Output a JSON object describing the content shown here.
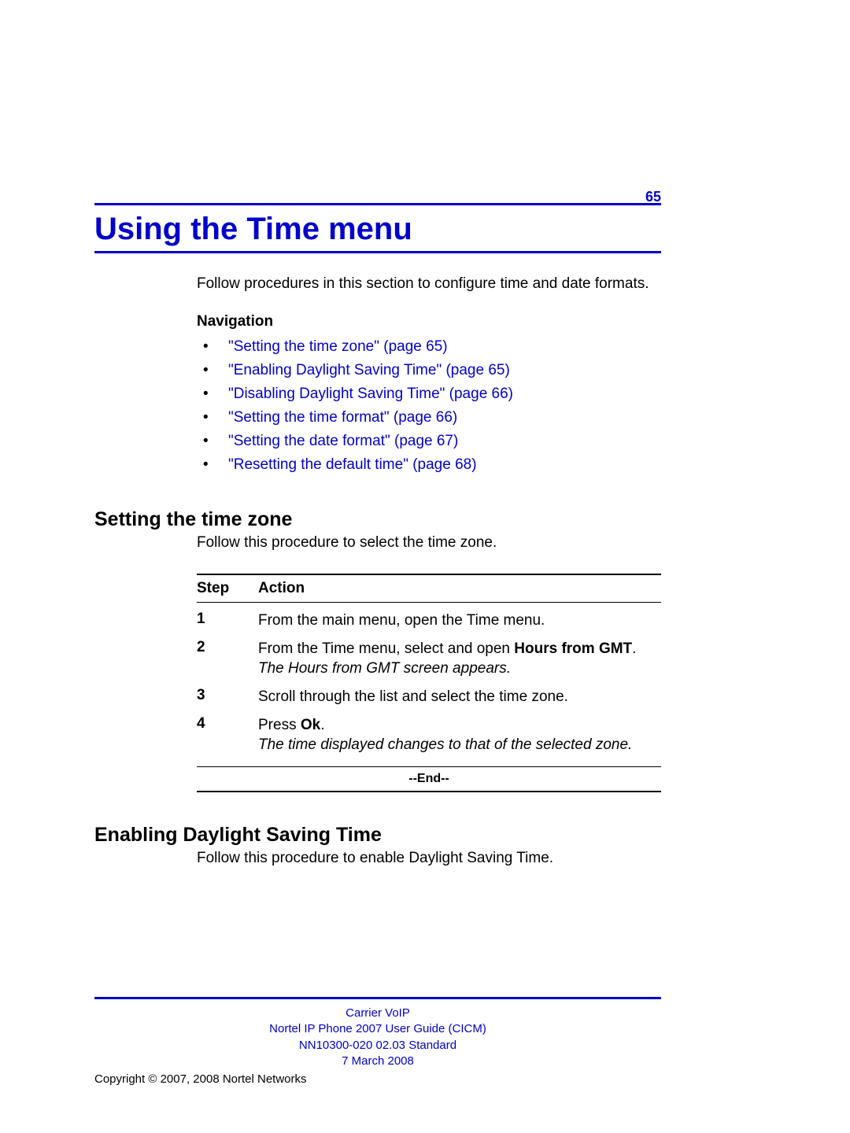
{
  "page_number": "65",
  "chapter_title": "Using the Time menu",
  "intro": "Follow procedures in this section to configure time and date formats.",
  "nav_heading": "Navigation",
  "nav_items": [
    "\"Setting the time zone\" (page 65)",
    "\"Enabling Daylight Saving Time\" (page 65)",
    "\"Disabling Daylight Saving Time\" (page 66)",
    "\"Setting the time format\" (page 66)",
    "\"Setting the date format\" (page 67)",
    "\"Resetting the default time\" (page 68)"
  ],
  "section1": {
    "heading": "Setting the time zone",
    "intro": "Follow this procedure to select the time zone.",
    "table": {
      "head_step": "Step",
      "head_action": "Action",
      "rows": [
        {
          "step": "1",
          "action_plain": "From the main menu, open the Time menu."
        },
        {
          "step": "2",
          "action_pre": "From the Time menu, select and open ",
          "action_bold": "Hours from GMT",
          "action_post": ".",
          "action_italic": "The Hours from GMT screen appears."
        },
        {
          "step": "3",
          "action_plain": "Scroll through the list and select the time zone."
        },
        {
          "step": "4",
          "action_pre": "Press ",
          "action_bold": "Ok",
          "action_post": ".",
          "action_italic": "The time displayed changes to that of the selected zone."
        }
      ],
      "end_label": "--End--"
    }
  },
  "section2": {
    "heading": "Enabling Daylight Saving Time",
    "intro": "Follow this procedure to enable Daylight Saving Time."
  },
  "footer": {
    "line1": "Carrier VoIP",
    "line2": "Nortel IP Phone 2007 User Guide (CICM)",
    "line3": "NN10300-020   02.03   Standard",
    "line4": "7 March 2008",
    "copyright": "Copyright © 2007, 2008 Nortel Networks"
  }
}
